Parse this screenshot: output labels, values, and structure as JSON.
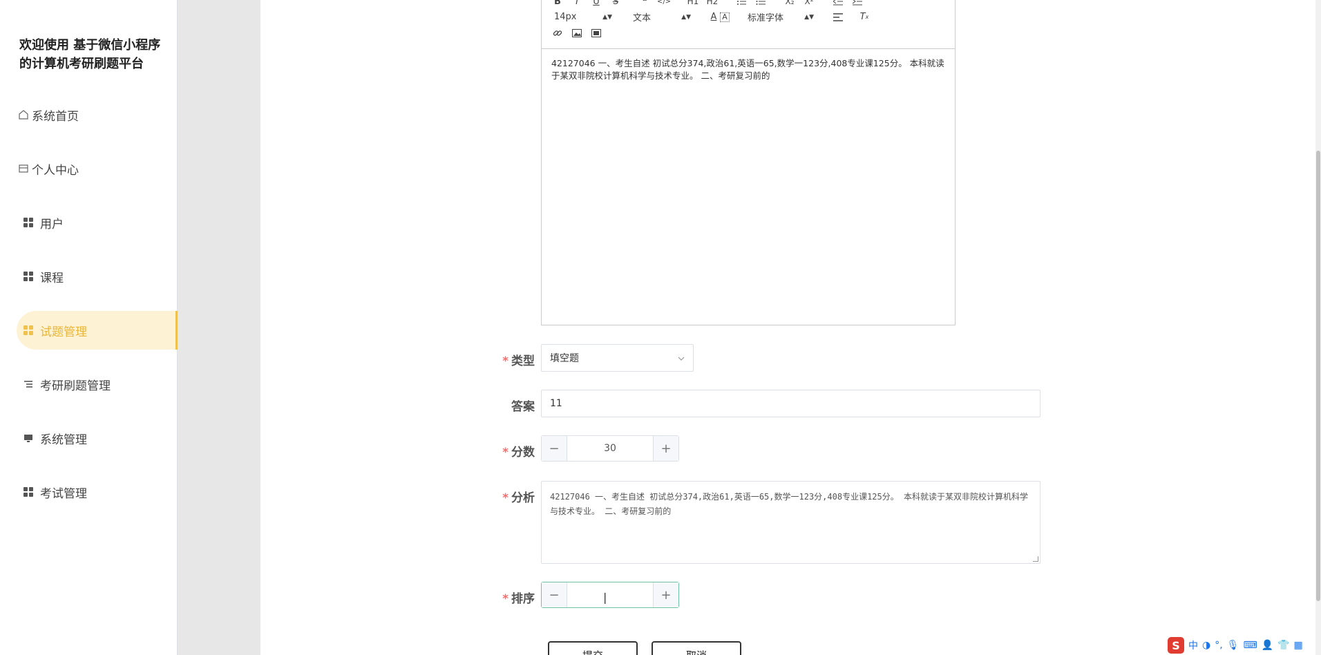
{
  "sidebar": {
    "brand_title": "欢迎使用 基于微信小程序的计算机考研刷题平台",
    "items": [
      {
        "label": "系统首页",
        "icon": "home-icon"
      },
      {
        "label": "个人中心",
        "icon": "id-card-icon"
      },
      {
        "label": "用户",
        "icon": "grid-icon"
      },
      {
        "label": "课程",
        "icon": "grid-icon"
      },
      {
        "label": "试题管理",
        "icon": "grid-icon",
        "active": true
      },
      {
        "label": "考研刷题管理",
        "icon": "list-icon"
      },
      {
        "label": "系统管理",
        "icon": "monitor-icon"
      },
      {
        "label": "考试管理",
        "icon": "grid-icon"
      }
    ]
  },
  "editor": {
    "toolbar": {
      "row1": [
        "B",
        "I",
        "U",
        "S",
        "❝",
        "</>",
        "H1",
        "H2",
        "ol",
        "ul",
        "X₂",
        "X²",
        "outdent",
        "indent"
      ],
      "font_size": "14px",
      "text_style": "文本",
      "font_family": "标准字体"
    },
    "content": "42127046 一、考生自述 初试总分374,政治61,英语一65,数学一123分,408专业课125分。 本科就读于某双非院校计算机科学与技术专业。 二、考研复习前的"
  },
  "form": {
    "type_label": "类型",
    "type_value": "填空题",
    "answer_label": "答案",
    "answer_value": "11",
    "score_label": "分数",
    "score_value": "30",
    "analysis_label": "分析",
    "analysis_value": "42127046 一、考生自述 初试总分374,政治61,英语一65,数学一123分,408专业课125分。 本科就读于某双非院校计算机科学与技术专业。 二、考研复习前的",
    "order_label": "排序",
    "order_value": "",
    "submit_label": "提交",
    "cancel_label": "取消"
  },
  "ime": {
    "logo": "S",
    "mode": "中"
  },
  "colors": {
    "accent_active_bg": "#fdf3d4",
    "accent_active": "#f0c24d",
    "required": "#f56c6c",
    "focus": "#6fc3a3"
  }
}
